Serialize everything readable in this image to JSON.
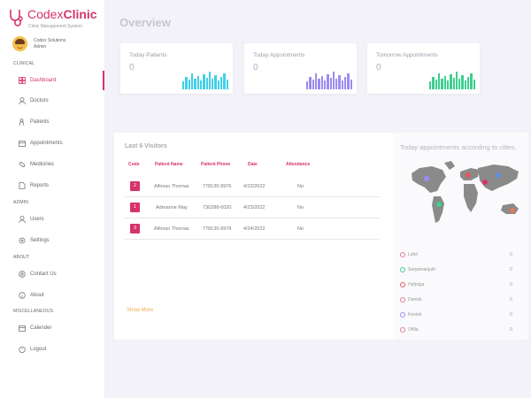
{
  "brand": {
    "name_plain": "Codex",
    "name_bold": "Clinic",
    "subtitle": "Clinic Management System"
  },
  "user": {
    "name": "Codex Solutions",
    "role": "Admin"
  },
  "sidebar": {
    "sections": {
      "clinical": "CLINICAL",
      "admin": "ADMIN",
      "about": "ABOUT",
      "misc": "MISCELLANEOUS"
    },
    "items": [
      {
        "label": "Dashboard",
        "icon": "dashboard-icon",
        "active": true
      },
      {
        "label": "Doctors",
        "icon": "doctor-icon"
      },
      {
        "label": "Patients",
        "icon": "patient-icon"
      },
      {
        "label": "Appointments",
        "icon": "calendar-icon"
      },
      {
        "label": "Medicines",
        "icon": "pill-icon"
      },
      {
        "label": "Reports",
        "icon": "report-icon"
      },
      {
        "label": "Users",
        "icon": "user-icon"
      },
      {
        "label": "Settings",
        "icon": "gear-icon"
      },
      {
        "label": "Contact Us",
        "icon": "contact-icon"
      },
      {
        "label": "About",
        "icon": "info-icon"
      },
      {
        "label": "Calender",
        "icon": "calendar-icon"
      },
      {
        "label": "Logout",
        "icon": "logout-icon"
      }
    ]
  },
  "main": {
    "title": "Overview",
    "stats": [
      {
        "title": "Today Patients",
        "value": "0",
        "color": "#3fd0e8"
      },
      {
        "title": "Today Appointments",
        "value": "0",
        "color": "#9b8cf0"
      },
      {
        "title": "Tomorrow Appointments",
        "value": "0",
        "color": "#3ccf8e"
      }
    ],
    "visitors": {
      "title": "Last 6 Visitors",
      "columns": [
        "Code",
        "Patient Name",
        "Patient Phone",
        "Date",
        "Attendance"
      ],
      "rows": [
        {
          "code": "2",
          "name": "Alfonso Thomas",
          "phone": "778135-9976",
          "date": "4/23/2022",
          "attendance": "No"
        },
        {
          "code": "1",
          "name": "Adreanne May",
          "phone": "730288-6020",
          "date": "4/23/2022",
          "attendance": "No"
        },
        {
          "code": "3",
          "name": "Alfonso Thomas",
          "phone": "778135-9978",
          "date": "4/24/2022",
          "attendance": "No"
        }
      ],
      "show_more": "Show More"
    },
    "cities": {
      "title": "Today appointments according to cities.",
      "list": [
        {
          "name": "Lebit",
          "value": "0",
          "color": "#e07aa0"
        },
        {
          "name": "Sarpamanjuth",
          "value": "0",
          "color": "#3ccf8e"
        },
        {
          "name": "Hafpiiga",
          "value": "0",
          "color": "#e05a5a"
        },
        {
          "name": "Damsk",
          "value": "0",
          "color": "#e07aa0"
        },
        {
          "name": "Kentok",
          "value": "0",
          "color": "#9b8cf0"
        },
        {
          "name": "Offila",
          "value": "0",
          "color": "#e07aa0"
        }
      ]
    }
  }
}
